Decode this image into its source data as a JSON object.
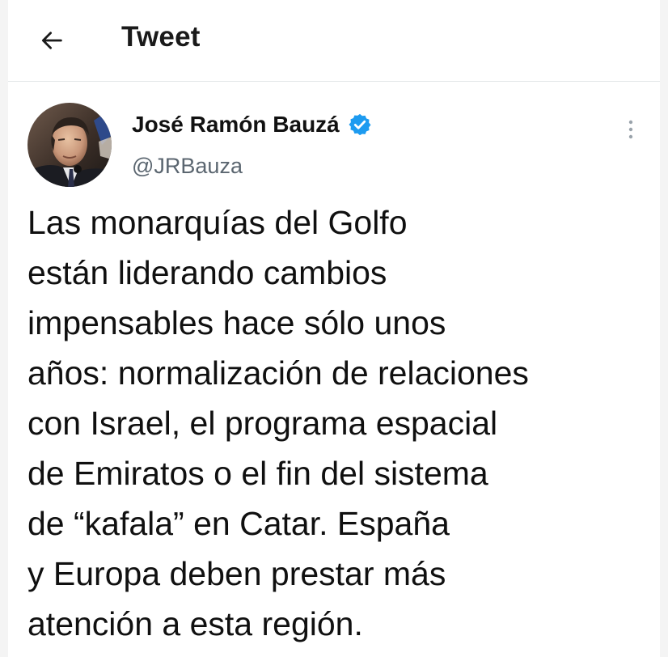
{
  "header": {
    "back_icon": "arrow-left-icon",
    "title": "Tweet"
  },
  "tweet": {
    "author": {
      "name": "José Ramón Bauzá",
      "handle": "@JRBauza",
      "verified": true,
      "verified_icon": "verified-badge-icon"
    },
    "more_icon": "vertical-ellipsis-icon",
    "text_lines": [
      "Las monarquías del Golfo",
      "están liderando cambios",
      "impensables hace sólo unos",
      "años: normalización de relaciones",
      "con Israel, el programa espacial",
      "de Emiratos o el fin del sistema",
      "de “kafala” en Catar. España",
      "y Europa deben prestar más",
      "atención a esta región."
    ]
  },
  "colors": {
    "verified_blue": "#1d9bf0",
    "text_primary": "#101010",
    "text_secondary": "#5b6670",
    "divider": "#e3e6e8"
  }
}
